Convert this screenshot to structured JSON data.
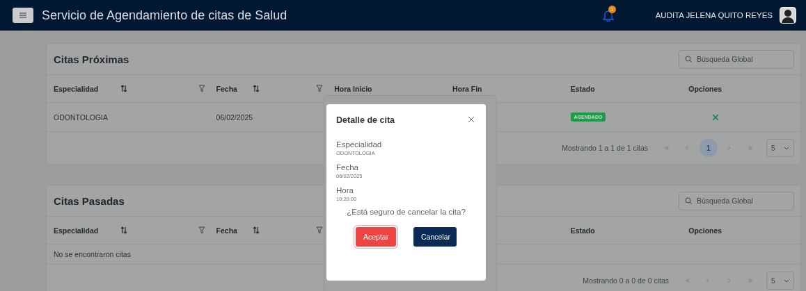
{
  "header": {
    "title": "Servicio de Agendamiento de citas de Salud",
    "notification_count": "1",
    "user_name": "AUDITA JELENA QUITO REYES"
  },
  "tables": [
    {
      "title": "Citas Próximas",
      "search": {
        "placeholder": "Búsqueda Global"
      },
      "columns": [
        {
          "label": "Especialidad",
          "sortable": true,
          "filterable": true
        },
        {
          "label": "Fecha",
          "sortable": true,
          "filterable": true
        },
        {
          "label": "Hora Inicio"
        },
        {
          "label": "Hora Fin"
        },
        {
          "label": "Estado"
        },
        {
          "label": "Opciones"
        }
      ],
      "rows": [
        {
          "especialidad": "ODONTOLOGIA",
          "fecha": "06/02/2025",
          "estado": {
            "label": "AGENDADO",
            "color": "#1f9a4b"
          },
          "cancelable": true
        }
      ],
      "summary": "Mostrando 1 a 1 de 1 citas",
      "pages": [
        {
          "label": "1",
          "selected": true
        }
      ],
      "page_size": "5"
    },
    {
      "title": "Citas Pasadas",
      "search": {
        "placeholder": "Búsqueda Global"
      },
      "columns": [
        {
          "label": "Especialidad",
          "sortable": true,
          "filterable": true
        },
        {
          "label": "Fecha",
          "sortable": true,
          "filterable": true
        },
        {},
        {},
        {
          "label": "Estado"
        },
        {
          "label": "Opciones"
        }
      ],
      "empty_message": "No se encontraron citas",
      "summary": "Mostrando 0 a 0 de 0 citas",
      "page_size": "5"
    }
  ],
  "dialog": {
    "title": "Detalle de cita",
    "fields": [
      {
        "label": "Especialidad",
        "value": "ODONTOLOGIA"
      },
      {
        "label": "Fecha",
        "value": "06/02/2025"
      },
      {
        "label": "Hora",
        "value": "10:20:00"
      }
    ],
    "question": "¿Está seguro de cancelar la cita?",
    "buttons": [
      {
        "label": "Aceptar",
        "kind": "danger"
      },
      {
        "label": "Cancelar",
        "kind": "primary"
      }
    ]
  }
}
